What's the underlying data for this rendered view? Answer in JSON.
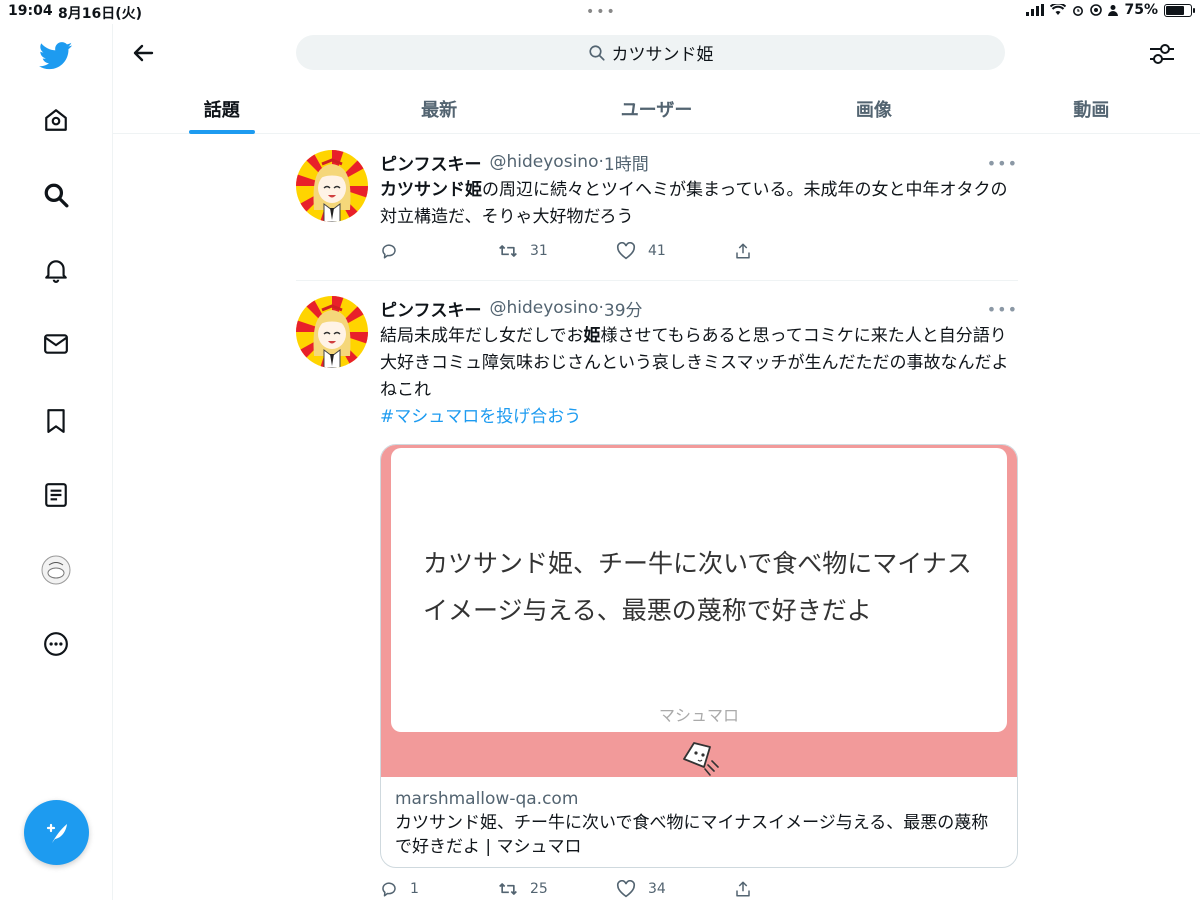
{
  "status_bar": {
    "time": "19:04",
    "date": "8月16日(火)",
    "battery": "75%",
    "battery_level": 0.75
  },
  "sidebar": {
    "items": [
      {
        "name": "twitter-logo-icon"
      },
      {
        "name": "home-icon"
      },
      {
        "name": "explore-search-icon"
      },
      {
        "name": "notifications-bell-icon"
      },
      {
        "name": "messages-mail-icon"
      },
      {
        "name": "bookmarks-icon"
      },
      {
        "name": "lists-icon"
      },
      {
        "name": "profile-avatar"
      },
      {
        "name": "more-options-icon"
      }
    ],
    "compose_icon": "compose-feather-icon"
  },
  "header": {
    "search_query": "カツサンド姫",
    "back_icon": "back-arrow-icon",
    "filter_icon": "search-filter-icon"
  },
  "tabs": [
    {
      "label": "話題",
      "active": true
    },
    {
      "label": "最新",
      "active": false
    },
    {
      "label": "ユーザー",
      "active": false
    },
    {
      "label": "画像",
      "active": false
    },
    {
      "label": "動画",
      "active": false
    }
  ],
  "tweets": [
    {
      "name": "ピンフスキー",
      "handle": "@hideyosino",
      "sep": "·",
      "ago": "1時間",
      "text_bold": "カツサンド姫",
      "text_rest": "の周辺に続々とツイヘミが集まっている。未成年の女と中年オタクの対立構造だ、そりゃ大好物だろう",
      "replies": "",
      "retweets": "31",
      "likes": "41"
    },
    {
      "name": "ピンフスキー",
      "handle": "@hideyosino",
      "sep": "·",
      "ago": "39分",
      "text_before": "結局未成年だし女だしでお",
      "text_bold": "姫",
      "text_after": "様させてもらあると思ってコミケに来た人と自分語り大好きコミュ障気味おじさんという哀しきミスマッチが生んだただの事故なんだよねこれ",
      "hashtag": "#マシュマロを投げ合おう",
      "card": {
        "question": "カツサンド姫、チー牛に次いで食べ物にマイナスイメージ与える、最悪の蔑称で好きだよ",
        "brand": "マシュマロ",
        "domain": "marshmallow-qa.com",
        "title": "カツサンド姫、チー牛に次いで食べ物にマイナスイメージ与える、最悪の蔑称で好きだよ | マシュマロ"
      },
      "replies": "1",
      "retweets": "25",
      "likes": "34"
    }
  ],
  "colors": {
    "accent": "#1d9bf0",
    "card_pink": "#f29a9a"
  }
}
